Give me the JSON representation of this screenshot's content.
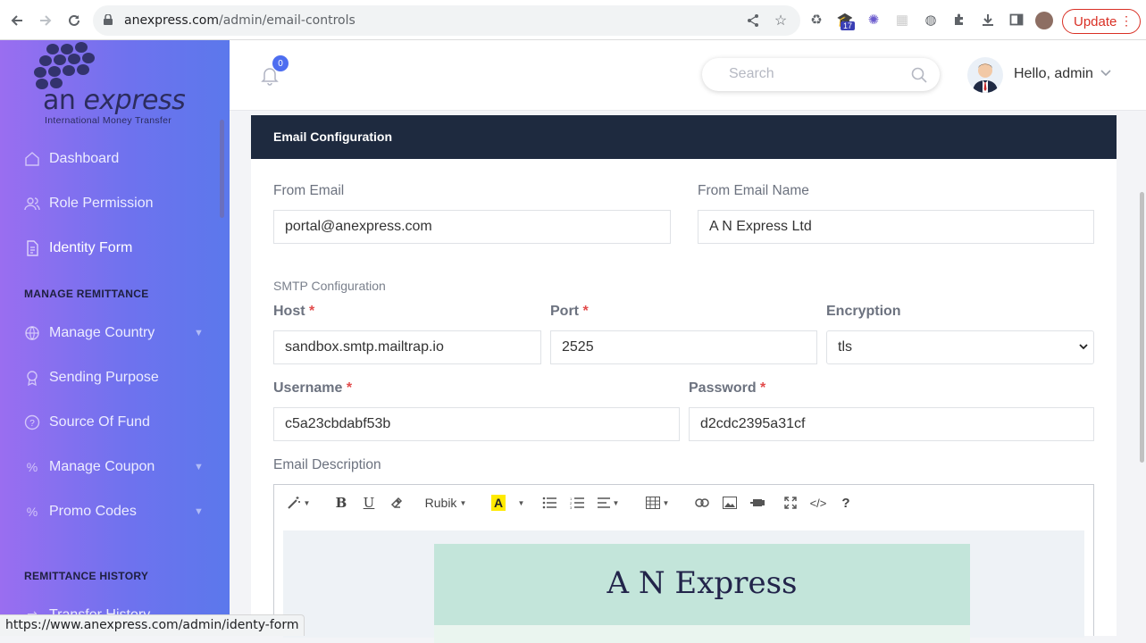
{
  "browser": {
    "url_host": "anexpress.com",
    "url_path": "/admin/email-controls",
    "update_label": "Update",
    "extension_badge": "17",
    "status_url": "https://www.anexpress.com/admin/identy-form"
  },
  "sidebar": {
    "logo_an": "an",
    "logo_express": "express",
    "logo_sub": "International Money Transfer",
    "items": [
      {
        "label": "Dashboard",
        "icon": "home-icon"
      },
      {
        "label": "Role Permission",
        "icon": "users-icon"
      },
      {
        "label": "Identity Form",
        "icon": "document-icon"
      },
      {
        "label": "Manage Country",
        "icon": "globe-icon"
      },
      {
        "label": "Sending Purpose",
        "icon": "award-icon"
      },
      {
        "label": "Source Of Fund",
        "icon": "question-circle-icon"
      },
      {
        "label": "Manage Coupon",
        "icon": "percent-icon"
      },
      {
        "label": "Promo Codes",
        "icon": "percent-icon"
      },
      {
        "label": "Transfer History",
        "icon": "history-icon"
      }
    ],
    "section_remittance": "MANAGE REMITTANCE",
    "section_history": "REMITTANCE HISTORY"
  },
  "header": {
    "notification_count": "0",
    "search_placeholder": "Search",
    "greeting": "Hello, admin"
  },
  "form": {
    "title": "Email Configuration",
    "from_email_label": "From Email",
    "from_email_value": "portal@anexpress.com",
    "from_name_label": "From Email Name",
    "from_name_value": "A N Express Ltd",
    "smtp_heading": "SMTP Configuration",
    "host_label": "Host",
    "host_value": "sandbox.smtp.mailtrap.io",
    "port_label": "Port",
    "port_value": "2525",
    "encryption_label": "Encryption",
    "encryption_value": "tls",
    "username_label": "Username",
    "username_value": "c5a23cbdabf53b",
    "password_label": "Password",
    "password_value": "d2cdc2395a31cf",
    "description_label": "Email Description",
    "required_mark": "*"
  },
  "editor": {
    "font_name": "Rubik",
    "bold": "B",
    "underline": "U",
    "help": "?",
    "code": "</>",
    "banner_title": "A N Express"
  }
}
